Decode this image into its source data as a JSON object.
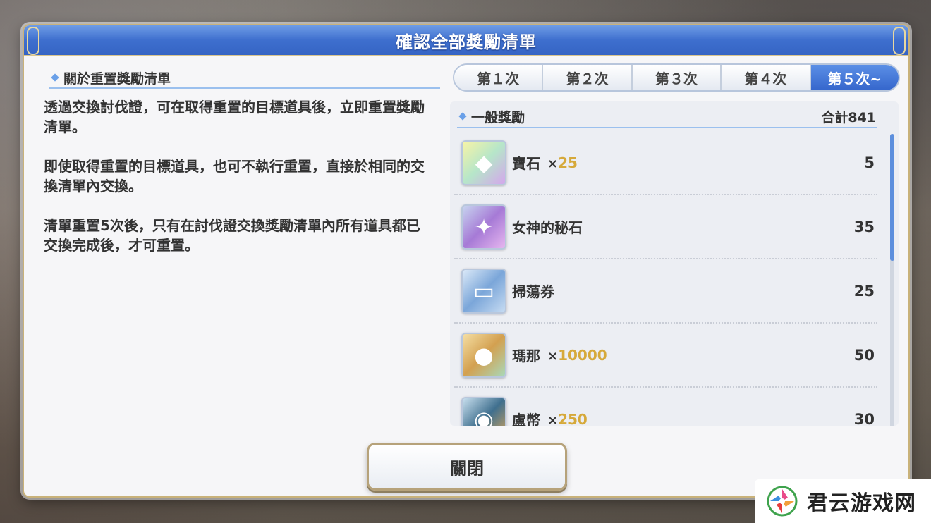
{
  "dialog": {
    "title": "確認全部獎勵清單"
  },
  "info": {
    "heading": "關於重置獎勵清單",
    "paragraphs": [
      "透過交換討伐證，可在取得重置的目標道具後，立即重置獎勵清單。",
      "即使取得重置的目標道具，也可不執行重置，直接於相同的交換清單內交換。",
      "清單重置5次後，只有在討伐證交換獎勵清單內所有道具都已交換完成後，才可重置。"
    ]
  },
  "tabs": [
    {
      "label": "第１次",
      "active": false
    },
    {
      "label": "第２次",
      "active": false
    },
    {
      "label": "第３次",
      "active": false
    },
    {
      "label": "第４次",
      "active": false
    },
    {
      "label": "第５次~",
      "active": true
    }
  ],
  "rewards": {
    "heading": "一般獎勵",
    "total": "合計841",
    "items": [
      {
        "icon": "gem-icon",
        "name": "寶石",
        "qty": "25",
        "count": "5",
        "color": "#cfe8a8"
      },
      {
        "icon": "goddess-stone-icon",
        "name": "女神的秘石",
        "qty": "",
        "count": "35",
        "color": "#c9a6e6"
      },
      {
        "icon": "sweep-ticket-icon",
        "name": "掃蕩券",
        "qty": "",
        "count": "25",
        "color": "#9cc3ea"
      },
      {
        "icon": "mana-icon",
        "name": "瑪那",
        "qty": "10000",
        "count": "50",
        "color": "#e6c27a"
      },
      {
        "icon": "rupee-coin-icon",
        "name": "盧幣",
        "qty": "250",
        "count": "30",
        "color": "#7aa9c9"
      }
    ]
  },
  "close_button": {
    "label": "關閉"
  },
  "bottom_nav": [],
  "watermark": {
    "text": "君云游戏网"
  }
}
